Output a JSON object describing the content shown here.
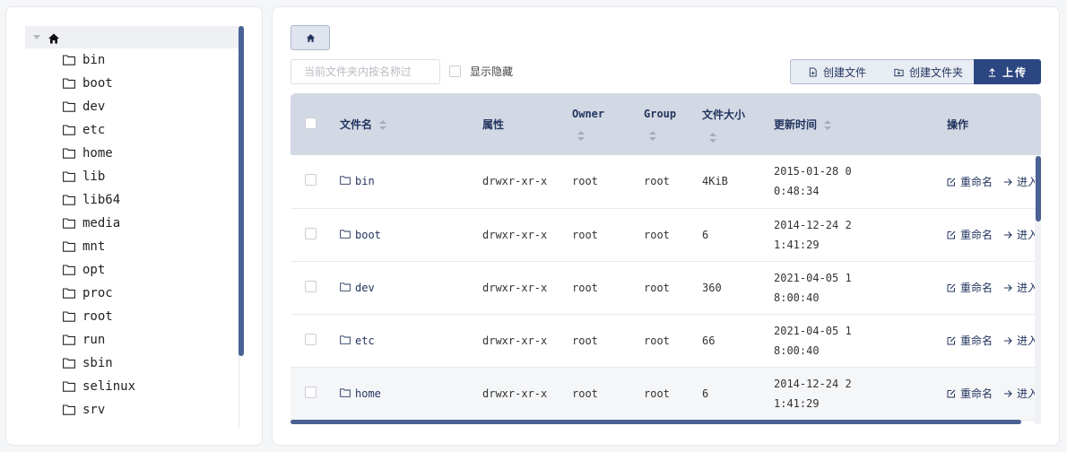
{
  "tree": {
    "root_icon": "home-icon",
    "items": [
      "bin",
      "boot",
      "dev",
      "etc",
      "home",
      "lib",
      "lib64",
      "media",
      "mnt",
      "opt",
      "proc",
      "root",
      "run",
      "sbin",
      "selinux",
      "srv"
    ]
  },
  "toolbar": {
    "home_icon": "home-icon",
    "filter_placeholder": "当前文件夹内按名称过",
    "show_hidden_label": "显示隐藏",
    "new_file_label": "创建文件",
    "new_folder_label": "创建文件夹",
    "upload_label": "上传"
  },
  "table": {
    "headers": {
      "name": "文件名",
      "attr": "属性",
      "owner": "Owner",
      "group": "Group",
      "size": "文件大小",
      "mtime": "更新时间",
      "ops": "操作"
    },
    "rows": [
      {
        "name": "bin",
        "attr": "drwxr-xr-x",
        "owner": "root",
        "group": "root",
        "size": "4KiB",
        "mtime_1": "2015-01-28 0",
        "mtime_2": "0:48:34"
      },
      {
        "name": "boot",
        "attr": "drwxr-xr-x",
        "owner": "root",
        "group": "root",
        "size": "6",
        "mtime_1": "2014-12-24 2",
        "mtime_2": "1:41:29"
      },
      {
        "name": "dev",
        "attr": "drwxr-xr-x",
        "owner": "root",
        "group": "root",
        "size": "360",
        "mtime_1": "2021-04-05 1",
        "mtime_2": "8:00:40"
      },
      {
        "name": "etc",
        "attr": "drwxr-xr-x",
        "owner": "root",
        "group": "root",
        "size": "66",
        "mtime_1": "2021-04-05 1",
        "mtime_2": "8:00:40"
      },
      {
        "name": "home",
        "attr": "drwxr-xr-x",
        "owner": "root",
        "group": "root",
        "size": "6",
        "mtime_1": "2014-12-24 2",
        "mtime_2": "1:41:29"
      }
    ],
    "op_rename": "重命名",
    "op_enter": "进入"
  },
  "colors": {
    "accent": "#2b4680",
    "header_bg": "#d3d9e4",
    "scroll": "#4a6193"
  }
}
